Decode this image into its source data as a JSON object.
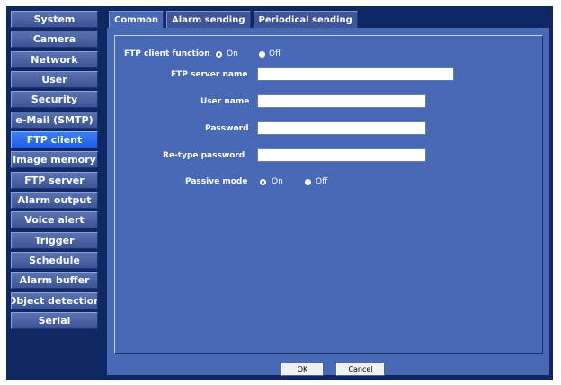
{
  "sidebar": {
    "items": [
      {
        "label": "System"
      },
      {
        "label": "Camera"
      },
      {
        "label": "Network"
      },
      {
        "label": "User"
      },
      {
        "label": "Security"
      },
      {
        "label": "e-Mail (SMTP)"
      },
      {
        "label": "FTP client"
      },
      {
        "label": "Image memory"
      },
      {
        "label": "FTP server"
      },
      {
        "label": "Alarm output"
      },
      {
        "label": "Voice alert"
      },
      {
        "label": "Trigger"
      },
      {
        "label": "Schedule"
      },
      {
        "label": "Alarm buffer"
      },
      {
        "label": "Object detection"
      },
      {
        "label": "Serial"
      }
    ],
    "active_index": 6
  },
  "tabs": [
    {
      "label": "Common"
    },
    {
      "label": "Alarm sending"
    },
    {
      "label": "Periodical sending"
    }
  ],
  "form": {
    "ftp_client_function": {
      "label": "FTP client function",
      "on": "On",
      "off": "Off",
      "selected": "On"
    },
    "ftp_server_name": {
      "label": "FTP server name",
      "value": ""
    },
    "user_name": {
      "label": "User name",
      "value": ""
    },
    "password": {
      "label": "Password",
      "value": ""
    },
    "retype_password": {
      "label": "Re-type password",
      "value": ""
    },
    "passive_mode": {
      "label": "Passive mode",
      "on": "On",
      "off": "Off",
      "selected": "On"
    }
  },
  "buttons": {
    "ok": "OK",
    "cancel": "Cancel"
  },
  "colors": {
    "background": "#0f2863",
    "panel": "#4869b6",
    "sidebar_item": "#4a64a6",
    "sidebar_active": "#2f6df0"
  }
}
